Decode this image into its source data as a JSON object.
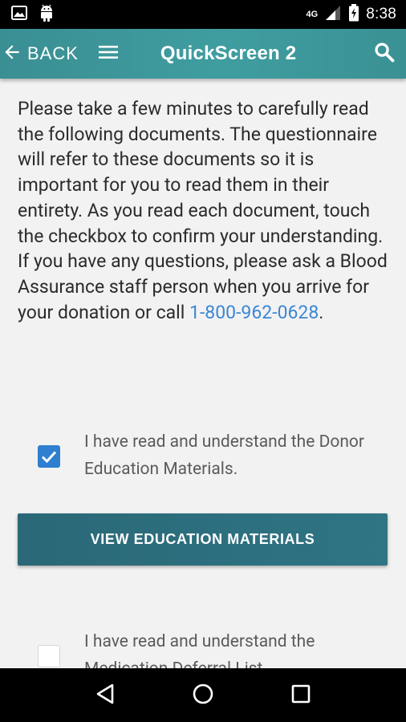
{
  "status_bar": {
    "network": "4G",
    "time": "8:38"
  },
  "app_bar": {
    "back_label": "BACK",
    "title": "QuickScreen 2"
  },
  "intro": {
    "text": "Please take a few minutes to carefully read the following documents. The questionnaire will refer to these documents so it is important for you to read them in their entirety. As you read each document, touch the checkbox to confirm your understanding. If you have any questions, please ask a Blood Assurance staff person when you arrive for your donation or call ",
    "phone": "1-800-962-0628",
    "end": "."
  },
  "checkboxes": [
    {
      "label": "I have read and understand the Donor Education Materials.",
      "checked": true
    },
    {
      "label": "I have read and understand the Medication Deferral List.",
      "checked": false
    }
  ],
  "view_button": {
    "label": "VIEW EDUCATION MATERIALS"
  },
  "colors": {
    "app_bar": "#3f9da0",
    "button": "#2f7584",
    "link": "#3a87d6",
    "checkbox": "#2f7fd0"
  },
  "icons": {
    "status_left": [
      "image-icon",
      "android-icon"
    ],
    "status_right": [
      "network-4g-icon",
      "signal-icon",
      "battery-charging-icon"
    ],
    "app_bar": [
      "back-arrow-icon",
      "menu-icon",
      "search-icon"
    ],
    "nav": [
      "nav-back-icon",
      "nav-home-icon",
      "nav-recents-icon"
    ]
  }
}
